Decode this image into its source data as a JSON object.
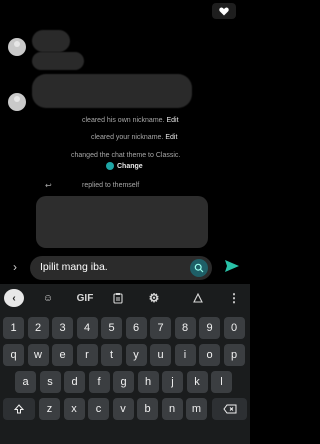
{
  "messages": {
    "sys1_text": "cleared his own nickname.",
    "sys1_action": "Edit",
    "sys2_text": "cleared your nickname.",
    "sys2_action": "Edit",
    "sys3_text": "changed the chat theme to Classic.",
    "sys3_action": "Change",
    "reply_label": "replied to themself"
  },
  "composer": {
    "text": "Ipilit mang iba."
  },
  "keyboard": {
    "toolbar": {
      "gif": "GIF"
    },
    "row1": [
      {
        "k": "1"
      },
      {
        "k": "2"
      },
      {
        "k": "3"
      },
      {
        "k": "4"
      },
      {
        "k": "5"
      },
      {
        "k": "6"
      },
      {
        "k": "7"
      },
      {
        "k": "8"
      },
      {
        "k": "9"
      },
      {
        "k": "0"
      }
    ],
    "row2": [
      "q",
      "w",
      "e",
      "r",
      "t",
      "y",
      "u",
      "i",
      "o",
      "p"
    ],
    "row3": [
      "a",
      "s",
      "d",
      "f",
      "g",
      "h",
      "j",
      "k",
      "l"
    ],
    "row4": [
      "z",
      "x",
      "c",
      "v",
      "b",
      "n",
      "m"
    ]
  }
}
